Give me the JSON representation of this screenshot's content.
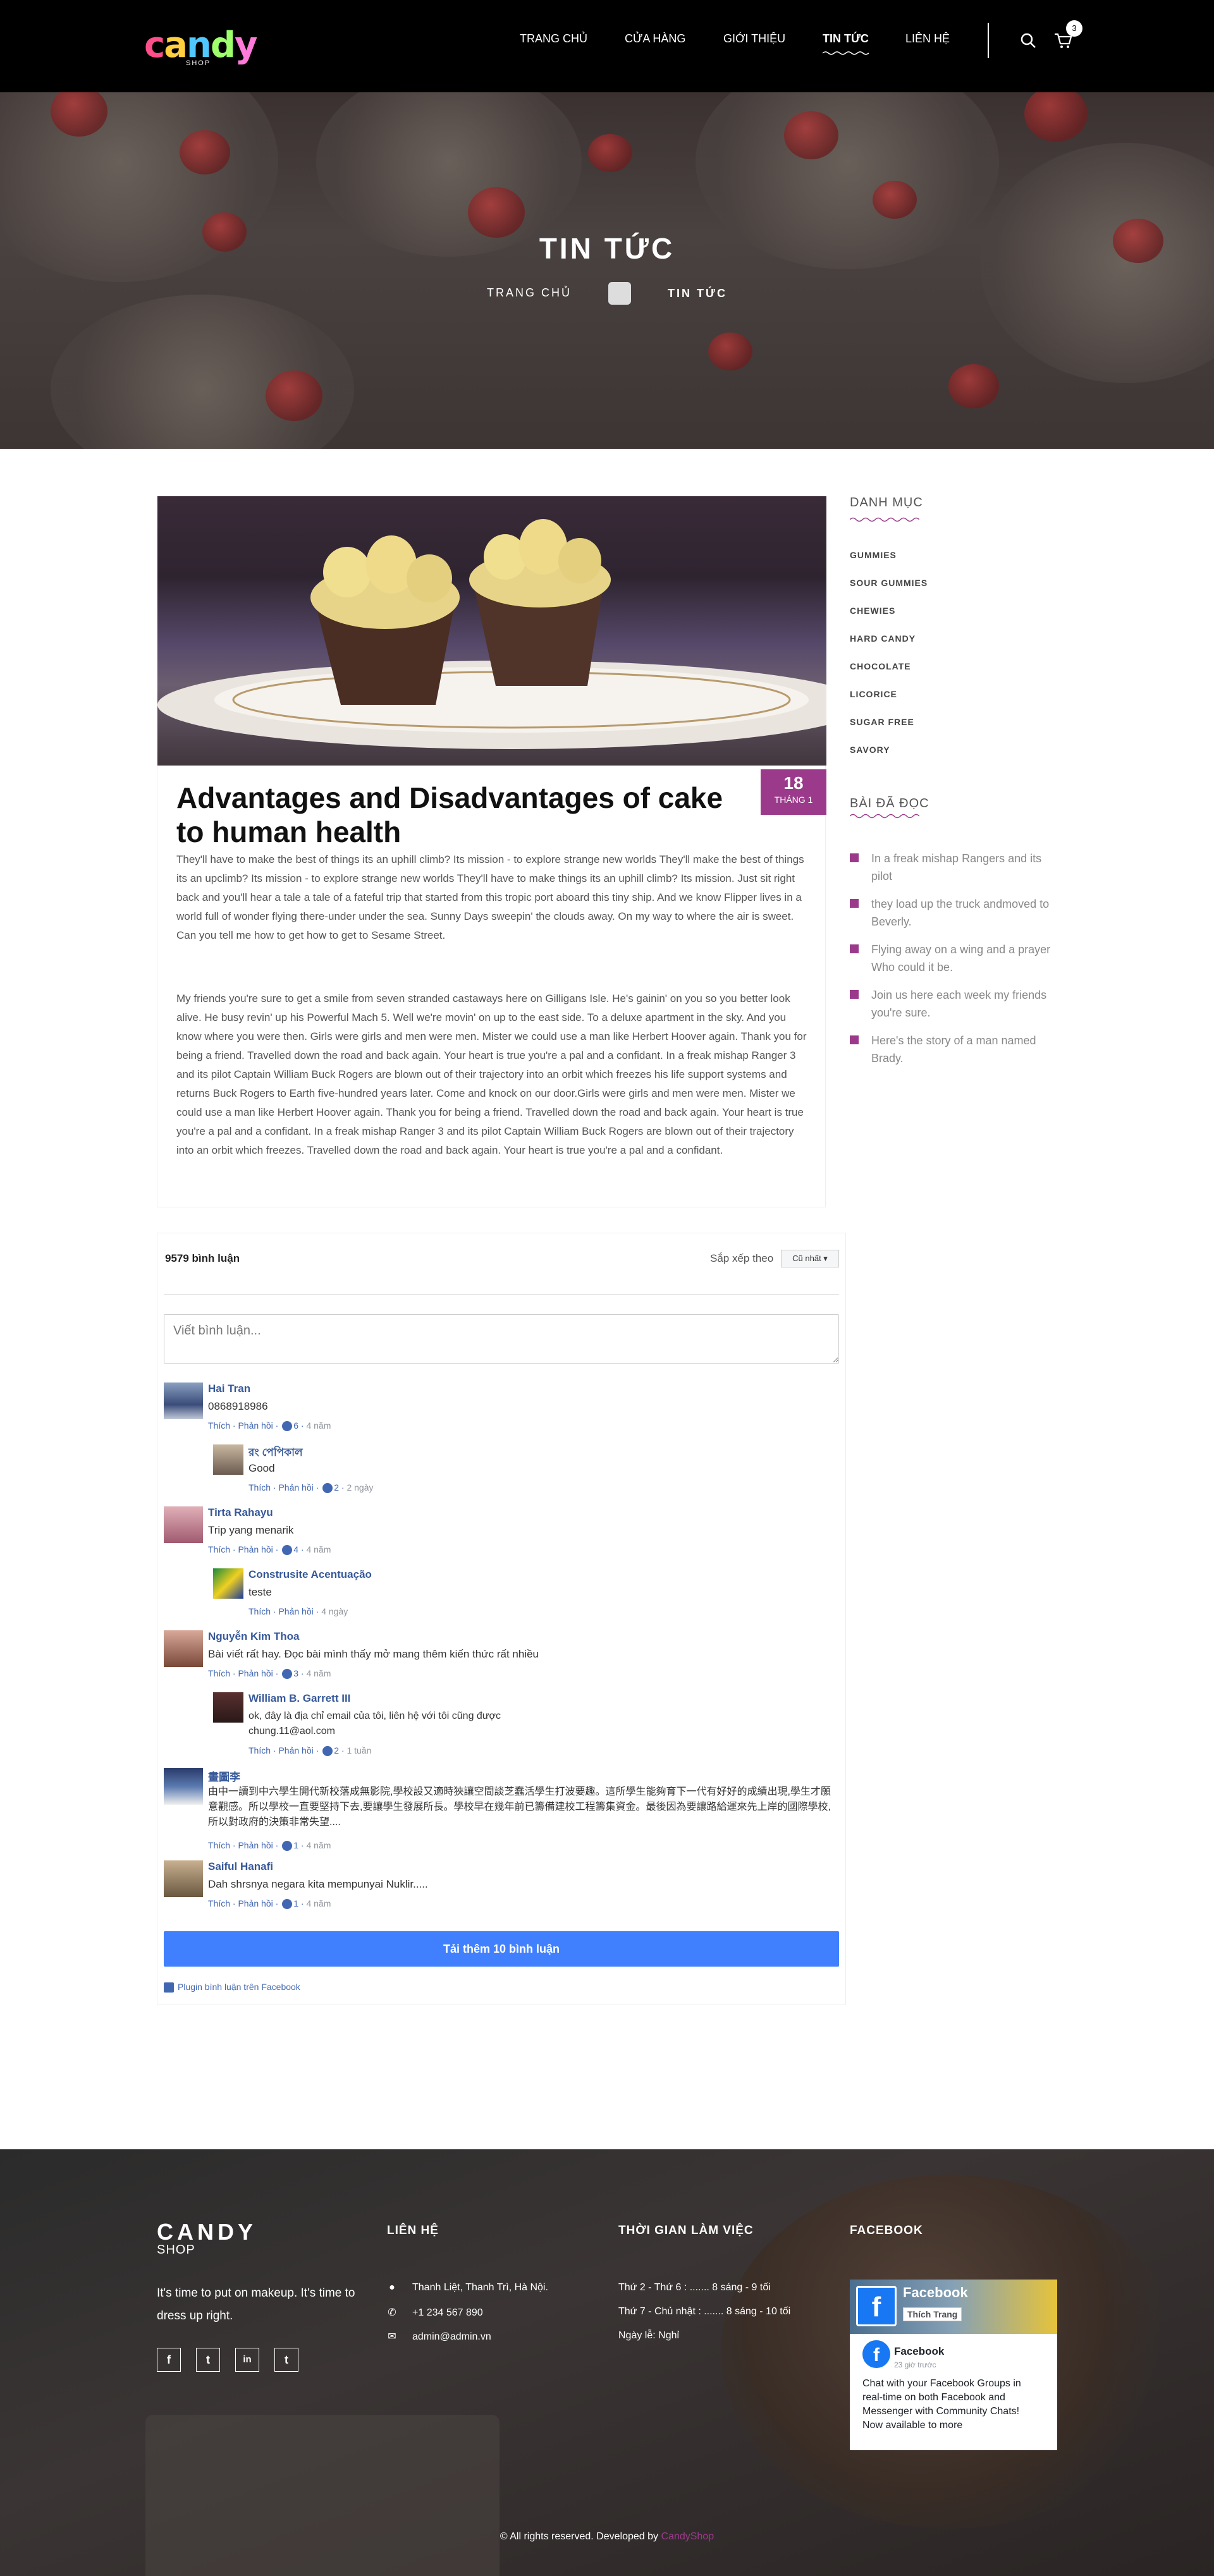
{
  "header": {
    "logo_text": "candy",
    "logo_sub": "SHOP",
    "nav": [
      {
        "label": "TRANG CHỦ",
        "active": false
      },
      {
        "label": "CỬA HÀNG",
        "active": false
      },
      {
        "label": "GIỚI THIỆU",
        "active": false
      },
      {
        "label": "TIN TỨC",
        "active": true
      },
      {
        "label": "LIÊN HỆ",
        "active": false
      }
    ],
    "cart_count": "3"
  },
  "hero": {
    "title": "TIN TỨC",
    "crumb_home": "TRANG CHỦ",
    "crumb_current": "TIN TỨC"
  },
  "article": {
    "date_day": "18",
    "date_month": "THÁNG 1",
    "title": "Advantages and Disadvantages of cake to human health",
    "para1": "They'll have to make the best of things its an uphill climb? Its mission - to explore strange new worlds They'll make the best of things its an upclimb? Its mission - to explore strange new worlds They'll have to make things its an uphill climb? Its mission. Just sit right back and you'll hear a tale a tale of a fateful trip that started from this tropic port aboard this tiny ship. And we know Flipper lives in a world full of wonder flying there-under under the sea. Sunny Days sweepin' the clouds away. On my way to where the air is sweet. Can you tell me how to get how to get to Sesame Street.",
    "para2": "My friends you're sure to get a smile from seven stranded castaways here on Gilligans Isle. He's gainin' on you so you better look alive. He busy revin' up his Powerful Mach 5. Well we're movin' on up to the east side. To a deluxe apartment in the sky. And you know where you were then. Girls were girls and men were men. Mister we could use a man like Herbert Hoover again. Thank you for being a friend. Travelled down the road and back again. Your heart is true you're a pal and a confidant. In a freak mishap Ranger 3 and its pilot Captain William Buck Rogers are blown out of their trajectory into an orbit which freezes his life support systems and returns Buck Rogers to Earth five-hundred years later. Come and knock on our door.Girls were girls and men were men. Mister we could use a man like Herbert Hoover again. Thank you for being a friend. Travelled down the road and back again. Your heart is true you're a pal and a confidant. In a freak mishap Ranger 3 and its pilot Captain William Buck Rogers are blown out of their trajectory into an orbit which freezes. Travelled down the road and back again. Your heart is true you're a pal and a confidant."
  },
  "comments": {
    "count_label": "9579 bình luận",
    "sort_label": "Sắp xếp theo",
    "sort_value": "Cũ nhất ▾",
    "input_placeholder": "Viết bình luận...",
    "like": "Thích",
    "reply": "Phản hồi",
    "items": [
      {
        "name": "Hai Tran",
        "text": "0868918986",
        "likes": "6",
        "time": "4 năm"
      },
      {
        "name": "রং পেপিকাল",
        "text": "Good",
        "likes": "2",
        "time": "2 ngày"
      },
      {
        "name": "Tirta Rahayu",
        "text": "Trip yang menarik",
        "likes": "4",
        "time": "4 năm"
      },
      {
        "name": "Construsite Acentuação",
        "text": "teste",
        "likes": "",
        "time": "4 ngày"
      },
      {
        "name": "Nguyễn Kim Thoa",
        "text": "Bài viết rất hay. Đọc bài mình thấy mở mang thêm kiến thức rất nhiều",
        "likes": "3",
        "time": "4 năm"
      },
      {
        "name": "William B. Garrett III",
        "text": "ok, đây là địa chỉ email của tôi, liên hệ với tôi cũng được chung.11@aol.com",
        "likes": "2",
        "time": "1 tuần"
      },
      {
        "name": "畫圖李",
        "text": "由中一讀到中六學生開代新校落成無影院,學校設又適時狹讓空間談芝蠢活學生打波要趣。這所學生能夠育下一代有好好的成績出現,學生才願意觀感。所以學校一直要堅持下去,要讓學生發展所長。學校早在幾年前已籌備建校工程籌集資金。最後因為要讓路給運來先上岸的國際學校,所以對政府的決策非常失望....",
        "likes": "1",
        "time": "4 năm"
      },
      {
        "name": "Saiful Hanafi",
        "text": "Dah shrsnya negara kita mempunyai Nuklir.....",
        "likes": "1",
        "time": "4 năm"
      }
    ],
    "load_more": "Tải thêm 10 bình luận",
    "plugin": "Plugin bình luận trên Facebook"
  },
  "sidebar": {
    "categories_title": "DANH MỤC",
    "categories": [
      "GUMMIES",
      "SOUR GUMMIES",
      "CHEWIES",
      "HARD CANDY",
      "CHOCOLATE",
      "LICORICE",
      "SUGAR FREE",
      "SAVORY"
    ],
    "read_title": "BÀI ĐÃ ĐỌC",
    "read": [
      "In a freak mishap Rangers and its pilot",
      "they load up the truck andmoved to Beverly.",
      "Flying away on a wing and a prayer Who could it be.",
      "Join us here each week my friends you're sure.",
      "Here's the story of a man named Brady."
    ]
  },
  "footer": {
    "brand": "CANDY",
    "brand_sub": "SHOP",
    "tagline": "It's time to put on makeup. It's time to dress up right.",
    "social": [
      "f",
      "t",
      "in",
      "t"
    ],
    "contact_title": "LIÊN HỆ",
    "address": "Thanh Liệt, Thanh Trì, Hà Nội.",
    "phone": "+1 234 567 890",
    "email": "admin@admin.vn",
    "hours_title": "THỜI GIAN LÀM VIỆC",
    "hours": [
      "Thứ 2 - Thứ 6 : ....... 8 sáng - 9 tối",
      "Thứ 7 - Chủ nhật : ....... 8 sáng - 10 tối",
      "Ngày lễ: Nghỉ"
    ],
    "facebook_title": "FACEBOOK",
    "fb_page": "Facebook",
    "fb_like": "Thích Trang",
    "fb_post_name": "Facebook",
    "fb_post_time": "23 giờ trước",
    "fb_post_text": "Chat with your Facebook Groups in real-time on both Facebook and Messenger with Community Chats! Now available to more",
    "copyright": "© All rights reserved. Developed by",
    "copyright_link": "CandyShop"
  },
  "colors": {
    "accent": "#9b3a8a",
    "header_bg": "#000000",
    "fb_blue": "#4267b2",
    "load_more": "#4080ff"
  }
}
